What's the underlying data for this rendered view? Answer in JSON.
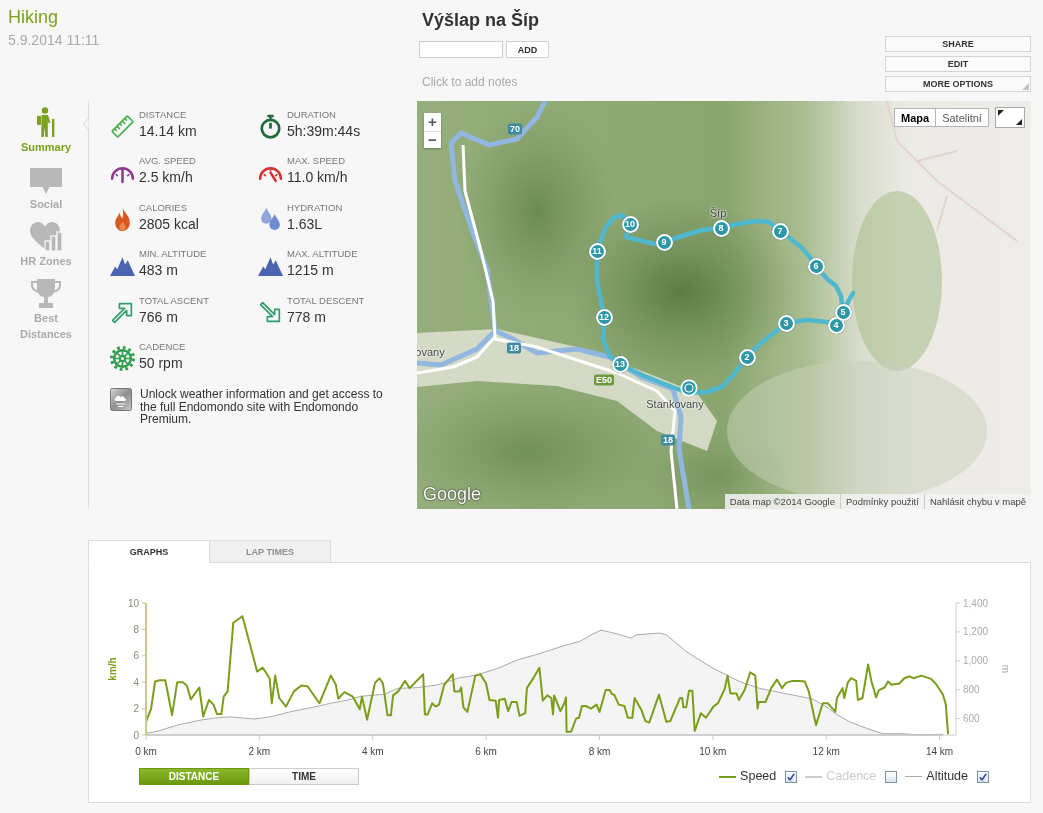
{
  "activity": {
    "sport": "Hiking",
    "date": "5.9.2014 11:11"
  },
  "workout": {
    "title": "Výšlap na Šíp",
    "add_button": "ADD",
    "notes_hint": "Click to add notes"
  },
  "actions": [
    {
      "label": "SHARE",
      "kind": "plain"
    },
    {
      "label": "EDIT",
      "kind": "plain"
    },
    {
      "label": "MORE OPTIONS",
      "kind": "menu"
    }
  ],
  "sidebar": {
    "items": [
      {
        "label": "Summary",
        "kind": "summary",
        "selected": true
      },
      {
        "label": "Social",
        "kind": "social",
        "selected": false
      },
      {
        "label": "HR Zones",
        "kind": "zones",
        "selected": false
      },
      {
        "label": "Best Distances",
        "kind": "records",
        "selected": false
      }
    ]
  },
  "stats": [
    {
      "label": "DISTANCE",
      "value": "14.14 km",
      "kind": "distance"
    },
    {
      "label": "DURATION",
      "value": "5h:39m:44s",
      "kind": "duration"
    },
    {
      "label": "AVG. SPEED",
      "value": "2.5 km/h",
      "kind": "avgspeed"
    },
    {
      "label": "MAX. SPEED",
      "value": "11.0 km/h",
      "kind": "maxspeed"
    },
    {
      "label": "CALORIES",
      "value": "2805 kcal",
      "kind": "calories"
    },
    {
      "label": "HYDRATION",
      "value": "1.63L",
      "kind": "hydration"
    },
    {
      "label": "MIN. ALTITUDE",
      "value": "483 m",
      "kind": "altitude"
    },
    {
      "label": "MAX. ALTITUDE",
      "value": "1215 m",
      "kind": "altitude"
    },
    {
      "label": "TOTAL ASCENT",
      "value": "766 m",
      "kind": "ascent"
    },
    {
      "label": "TOTAL DESCENT",
      "value": "778 m",
      "kind": "descent"
    },
    {
      "label": "CADENCE",
      "value": "50 rpm",
      "kind": "cadence"
    }
  ],
  "promo": {
    "text": "Unlock weather information and get access to the full Endomondo site with Endomondo Premium."
  },
  "map": {
    "zoom_in": "+",
    "zoom_out": "−",
    "types": [
      {
        "label": "Mapa",
        "selected": true
      },
      {
        "label": "Satelitní",
        "selected": false
      }
    ],
    "labels": [
      {
        "text": "Šíp",
        "kind": "place"
      },
      {
        "text": "Stankovany",
        "kind": "place"
      },
      {
        "text": "ovany",
        "kind": "place"
      },
      {
        "text": "70",
        "kind": "national"
      },
      {
        "text": "18",
        "kind": "national"
      },
      {
        "text": "E50",
        "kind": "european"
      },
      {
        "text": "18",
        "kind": "national"
      }
    ],
    "markers": [
      "2",
      "3",
      "4",
      "5",
      "6",
      "7",
      "8",
      "9",
      "10",
      "11",
      "12",
      "13"
    ],
    "logo": "Google",
    "attribution": [
      "Data map ©2014 Google",
      "Podmínky použití",
      "Nahlásit chybu v mapě"
    ]
  },
  "graphs": {
    "tabs": [
      {
        "label": "GRAPHS",
        "selected": true
      },
      {
        "label": "LAP TIMES",
        "selected": false
      }
    ],
    "chart_data": {
      "type": "line",
      "ylabel": "km/h",
      "xlim": [
        0,
        14.29
      ],
      "ylim": [
        0,
        10
      ],
      "yticks": [
        0,
        2,
        4,
        6,
        8,
        10
      ],
      "xticks": [
        {
          "value": 0,
          "label": "0 km"
        },
        {
          "value": 2,
          "label": "2 km"
        },
        {
          "value": 4,
          "label": "4 km"
        },
        {
          "value": 6,
          "label": "6 km"
        },
        {
          "value": 8,
          "label": "8 km"
        },
        {
          "value": 10,
          "label": "10 km"
        },
        {
          "value": 12,
          "label": "12 km"
        },
        {
          "value": 14,
          "label": "14 km"
        }
      ],
      "y2label": "m",
      "y2lim": [
        487,
        1400
      ],
      "y2ticks": [
        {
          "value": 600,
          "label": "600"
        },
        {
          "value": 800,
          "label": "800"
        },
        {
          "value": 1000,
          "label": "1,000"
        },
        {
          "value": 1200,
          "label": "1,200"
        },
        {
          "value": 1400,
          "label": "1,400"
        }
      ],
      "x": [
        0,
        0.09,
        0.16,
        0.24,
        0.34,
        0.46,
        0.55,
        0.65,
        0.72,
        0.79,
        0.94,
        1.01,
        1.11,
        1.19,
        1.25,
        1.33,
        1.37,
        1.44,
        1.54,
        1.7,
        1.85,
        1.96,
        2.06,
        2.18,
        2.22,
        2.28,
        2.35,
        2.47,
        2.61,
        2.74,
        2.85,
        3.06,
        3.26,
        3.35,
        3.39,
        3.5,
        3.65,
        3.77,
        3.81,
        3.9,
        4.04,
        4.12,
        4.18,
        4.26,
        4.32,
        4.36,
        4.45,
        4.57,
        4.65,
        4.89,
        4.92,
        4.97,
        5.05,
        5.11,
        5.17,
        5.26,
        5.41,
        5.44,
        5.53,
        5.56,
        5.6,
        5.67,
        5.81,
        5.9,
        6.0,
        6.06,
        6.17,
        6.21,
        6.23,
        6.33,
        6.39,
        6.45,
        6.54,
        6.59,
        6.69,
        6.72,
        6.84,
        6.94,
        7.0,
        7.08,
        7.15,
        7.18,
        7.2,
        7.31,
        7.38,
        7.41,
        7.42,
        7.5,
        7.59,
        7.64,
        7.69,
        7.76,
        7.85,
        7.95,
        8.0,
        8.11,
        8.18,
        8.22,
        8.26,
        8.34,
        8.44,
        8.5,
        8.58,
        8.62,
        8.74,
        8.81,
        8.88,
        9.05,
        9.13,
        9.18,
        9.25,
        9.42,
        9.46,
        9.48,
        9.53,
        9.58,
        9.64,
        9.68,
        9.79,
        9.88,
        10.01,
        10.09,
        10.21,
        10.26,
        10.31,
        10.42,
        10.46,
        10.56,
        10.66,
        10.75,
        10.79,
        10.81,
        10.93,
        11.03,
        11.13,
        11.22,
        11.29,
        11.4,
        11.53,
        11.62,
        11.69,
        11.82,
        11.94,
        12.03,
        12.16,
        12.19,
        12.29,
        12.32,
        12.38,
        12.44,
        12.53,
        12.56,
        12.64,
        12.74,
        12.8,
        12.88,
        12.93,
        13.03,
        13.09,
        13.15,
        13.29,
        13.38,
        13.47,
        13.54,
        13.68,
        13.85,
        13.94,
        14.06,
        14.11,
        14.15
      ],
      "series": [
        {
          "name": "Speed",
          "type": "line",
          "color": "#7a9e1c",
          "values": [
            1.0,
            2.0,
            4.05,
            4.15,
            4.15,
            1.5,
            4.0,
            4.0,
            3.75,
            2.7,
            3.6,
            1.4,
            2.65,
            2.3,
            1.6,
            1.6,
            2.9,
            3.3,
            8.5,
            9.0,
            6.6,
            4.8,
            5.1,
            4.3,
            2.4,
            4.5,
            2.8,
            2.15,
            3.3,
            3.75,
            3.7,
            2.4,
            4.5,
            3.8,
            2.75,
            3.25,
            2.9,
            1.95,
            2.9,
            1.15,
            3.95,
            4.3,
            3.9,
            1.5,
            1.5,
            3.0,
            3.3,
            4.1,
            3.55,
            4.6,
            1.55,
            1.55,
            2.4,
            2.15,
            2.3,
            3.8,
            4.6,
            3.3,
            3.3,
            3.6,
            2.1,
            1.75,
            4.5,
            4.6,
            3.9,
            2.65,
            2.6,
            1.3,
            2.65,
            2.75,
            1.8,
            2.5,
            2.5,
            1.45,
            1.65,
            3.55,
            4.35,
            5.1,
            2.6,
            3.0,
            2.8,
            1.55,
            3.0,
            1.8,
            2.4,
            2.85,
            0.25,
            0.25,
            1.25,
            1.3,
            2.2,
            2.2,
            2.0,
            2.3,
            1.75,
            3.4,
            3.4,
            3.1,
            3.05,
            2.3,
            2.2,
            1.3,
            1.3,
            2.8,
            1.9,
            1.05,
            0.95,
            3.05,
            1.8,
            1.0,
            1.05,
            2.8,
            2.8,
            2.1,
            2.1,
            3.35,
            3.35,
            0.3,
            1.65,
            1.3,
            2.15,
            2.4,
            3.5,
            4.5,
            3.15,
            3.15,
            2.65,
            3.4,
            4.75,
            4.5,
            2.0,
            2.5,
            2.5,
            3.55,
            4.2,
            3.55,
            3.95,
            4.1,
            4.1,
            4.05,
            3.35,
            0.75,
            2.4,
            2.4,
            1.75,
            2.8,
            3.55,
            2.8,
            3.95,
            4.3,
            4.1,
            2.65,
            2.8,
            5.35,
            4.05,
            2.85,
            3.4,
            3.6,
            4.05,
            3.8,
            3.9,
            4.3,
            4.45,
            4.3,
            4.5,
            4.25,
            3.85,
            3.05,
            2.3,
            0.05
          ]
        },
        {
          "name": "Cadence",
          "type": "line",
          "color": "#cccccc",
          "values": [
            null,
            null,
            null,
            null,
            null,
            null,
            null,
            null,
            null,
            null,
            null,
            null,
            null,
            null,
            null,
            null,
            null,
            null,
            null,
            null,
            null,
            null,
            null,
            null,
            null,
            null,
            null,
            null,
            null,
            null,
            null,
            null,
            null,
            null,
            null,
            null,
            null,
            null,
            null,
            null,
            null,
            null,
            null,
            null,
            null,
            null,
            null,
            null,
            null,
            null,
            null,
            null,
            null,
            null,
            null,
            null,
            null,
            null,
            null,
            null,
            null,
            null,
            null,
            null,
            null,
            null,
            null,
            null,
            null,
            null,
            null,
            null,
            null,
            null,
            null,
            null,
            null,
            null,
            null,
            null,
            null,
            null,
            null,
            null,
            null,
            null,
            null,
            null,
            null,
            null,
            null,
            null,
            null,
            null,
            null,
            null,
            null,
            null,
            null,
            null,
            null,
            null,
            null,
            null,
            null,
            null,
            null,
            null,
            null,
            null,
            null,
            null,
            null,
            null,
            null,
            null,
            null,
            null,
            null,
            null,
            null,
            null,
            null,
            null,
            null,
            null,
            null,
            null,
            null,
            null,
            null,
            null,
            null,
            null,
            null,
            null,
            null,
            null,
            null,
            null,
            null,
            null,
            null,
            null,
            null,
            null,
            null,
            null,
            null,
            null,
            null,
            null,
            null,
            null,
            null,
            null,
            null,
            null,
            null,
            null,
            null,
            null,
            null,
            null,
            null,
            null,
            null,
            null,
            null,
            null
          ]
        },
        {
          "name": "Altitude",
          "type": "area",
          "axis": "y2",
          "color": "#aaaaaa",
          "x": [
            0,
            0.21,
            0.56,
            0.97,
            1.26,
            1.5,
            1.91,
            2.21,
            2.56,
            2.91,
            3.26,
            3.56,
            3.79,
            4.21,
            4.44,
            4.79,
            5.15,
            5.5,
            5.85,
            6.21,
            6.56,
            6.91,
            7.15,
            7.38,
            7.65,
            7.88,
            8.03,
            8.18,
            8.32,
            8.56,
            8.65,
            9.06,
            9.18,
            9.35,
            9.53,
            9.76,
            10.0,
            10.24,
            10.47,
            10.82,
            11.41,
            11.76,
            12.0,
            12.18,
            12.41,
            12.71,
            13.0,
            13.35,
            13.65,
            13.94,
            14.06
          ],
          "values": [
            498,
            514,
            556,
            591,
            607,
            612,
            598,
            614,
            649,
            676,
            706,
            729,
            755,
            769,
            810,
            815,
            834,
            880,
            903,
            949,
            1007,
            1046,
            1076,
            1106,
            1134,
            1185,
            1212,
            1199,
            1185,
            1157,
            1180,
            1192,
            1180,
            1123,
            1065,
            1007,
            949,
            903,
            857,
            810,
            764,
            736,
            683,
            630,
            579,
            533,
            496,
            496,
            487,
            491,
            491
          ]
        }
      ]
    },
    "legend": [
      {
        "checked": true
      },
      {
        "checked": false
      },
      {
        "checked": true
      }
    ],
    "axis_modes": [
      {
        "label": "DISTANCE",
        "selected": true
      },
      {
        "label": "TIME",
        "selected": false
      }
    ]
  }
}
